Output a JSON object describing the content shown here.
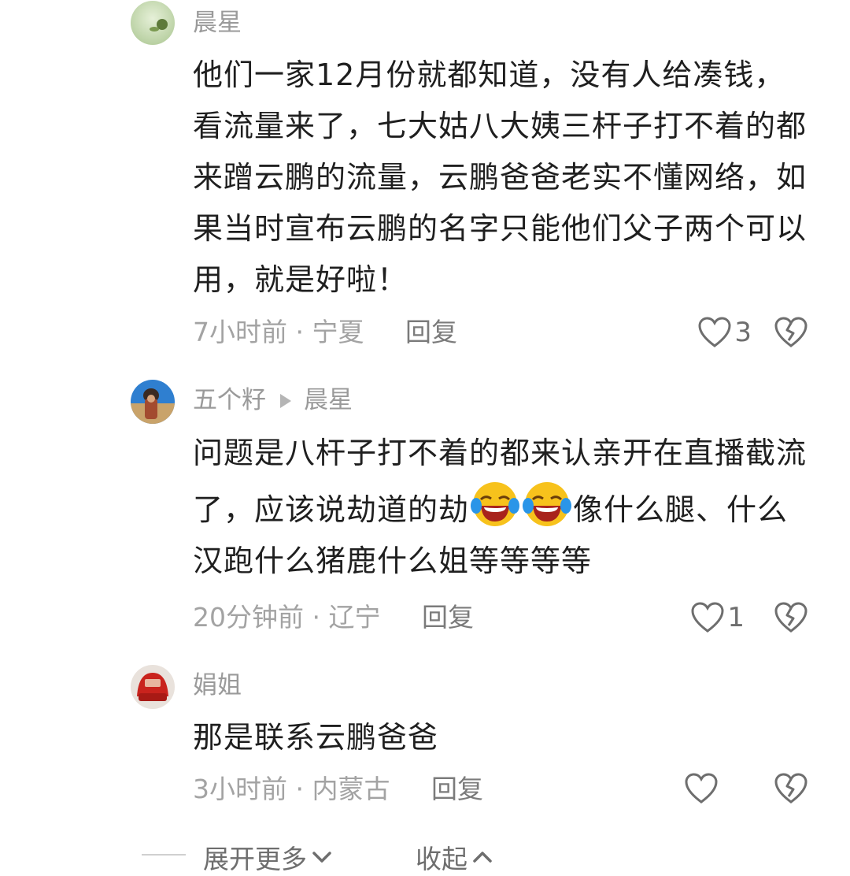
{
  "comments": [
    {
      "author": "晨星",
      "text": "他们一家12月份就都知道，没有人给凑钱，看流量来了，七大姑八大姨三杆子打不着的都来蹭云鹏的流量，云鹏爸爸老实不懂网络，如果当时宣布云鹏的名字只能他们父子两个可以用，就是好啦！",
      "time": "7小时前",
      "location": "宁夏",
      "reply_label": "回复",
      "like_count": "3"
    },
    {
      "author": "五个籽",
      "reply_to": "晨星",
      "text_part1": "问题是八杆子打不着的都来认亲开在直播截流了，应该说劫道的劫",
      "emoji_name": "crying-laughing-emoji",
      "text_part2": "像什么腿、什么汉跑什么猪鹿什么姐等等等等",
      "time": "20分钟前",
      "location": "辽宁",
      "reply_label": "回复",
      "like_count": "1"
    },
    {
      "author": "娟姐",
      "text": "那是联系云鹏爸爸",
      "time": "3小时前",
      "location": "内蒙古",
      "reply_label": "回复",
      "like_count": ""
    }
  ],
  "footer": {
    "expand_label": "展开更多",
    "collapse_label": "收起"
  },
  "colors": {
    "text": "#1f1f1f",
    "meta": "#a3a3a3",
    "icon": "#6e6e6e"
  }
}
